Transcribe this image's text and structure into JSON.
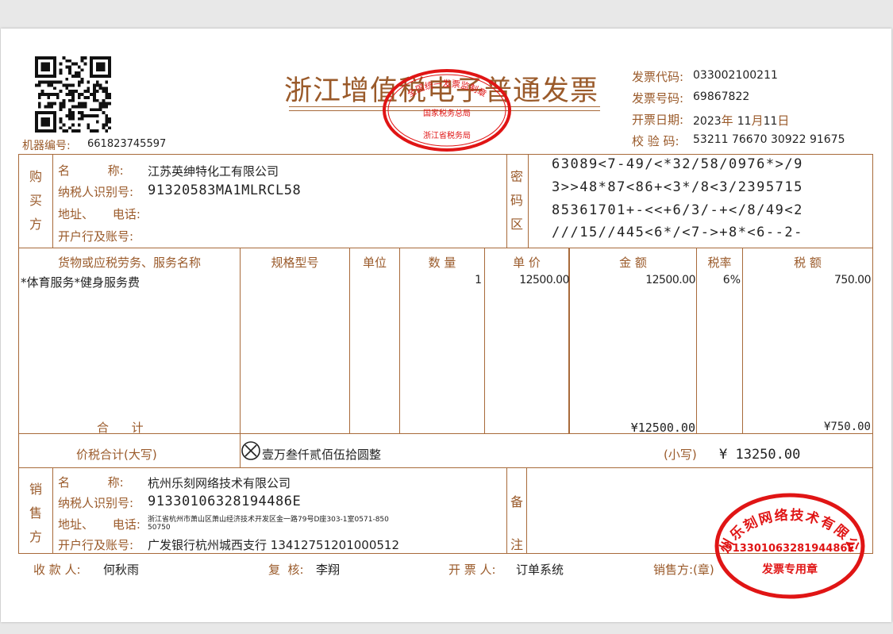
{
  "invoice": {
    "title": "浙江增值税电子普通发票",
    "machine_no_label": "机器编号:",
    "machine_no": "661823745597",
    "code_label": "发票代码:",
    "code": "033002100211",
    "number_label": "发票号码:",
    "number": "69867822",
    "date_label": "开票日期:",
    "date_year": "2023",
    "date_year_unit": "年",
    "date_month": "11",
    "date_month_unit": "月",
    "date_day": "11",
    "date_day_unit": "日",
    "check_label": "校 验 码:",
    "check_code": "53211 76670 30922 91675"
  },
  "tax_stamp": {
    "top_text": "全国统一发票监制章",
    "middle_text": "国家税务总局",
    "bottom_text": "浙江省税务局"
  },
  "buyer": {
    "side_label": [
      "购",
      "买",
      "方"
    ],
    "name_label": "名          称:",
    "name": "江苏英绅特化工有限公司",
    "tax_id_label": "纳税人识别号:",
    "tax_id": "91320583MA1MLRCL58",
    "address_label": "地址、     电话:",
    "address": "",
    "bank_label": "开户行及账号:",
    "bank": ""
  },
  "password_zone": {
    "side_label": [
      "密",
      "码",
      "区"
    ],
    "lines": [
      "63089<7-49/<*32/58/0976*>/9",
      "3>>48*87<86+<3*/8<3/2395715",
      "85361701+-<<+6/3/-+</8/49<2",
      "///15//445<6*/<7->+8*<6--2-"
    ]
  },
  "items_header": {
    "name": "货物或应税劳务、服务名称",
    "spec": "规格型号",
    "unit": "单位",
    "qty": "数 量",
    "price": "单 价",
    "amount": "金 额",
    "rate": "税率",
    "tax": "税 额"
  },
  "items": [
    {
      "name": "*体育服务*健身服务费",
      "spec": "",
      "unit": "",
      "qty": "1",
      "price": "12500.00",
      "amount": "12500.00",
      "rate": "6%",
      "tax": "750.00"
    }
  ],
  "totals": {
    "label": "合      计",
    "amount": "¥12500.00",
    "tax": "¥750.00",
    "grand_label": "价税合计(大写)",
    "grand_words": "壹万叁仟贰佰伍拾圆整",
    "small_label": "(小写)",
    "grand_number": "¥ 13250.00"
  },
  "seller": {
    "side_label": [
      "销",
      "售",
      "方"
    ],
    "name_label": "名          称:",
    "name": "杭州乐刻网络技术有限公司",
    "tax_id_label": "纳税人识别号:",
    "tax_id": "91330106328194486E",
    "address_label": "地址、     电话:",
    "address_line1": "浙江省杭州市萧山区萧山经济技术开发区金一路79号D座303-1室0571-850",
    "address_line2": "50750",
    "bank_label": "开户行及账号:",
    "bank": "广发银行杭州城西支行 13412751201000512"
  },
  "remarks": {
    "side_label": [
      "备",
      "注"
    ]
  },
  "seller_stamp": {
    "company": "杭州乐刻网络技术有限公司",
    "tax_id": "91330106328194486E",
    "caption": "发票专用章"
  },
  "footer": {
    "payee_label": "收 款 人:",
    "payee": "何秋雨",
    "reviewer_label": "复  核:",
    "reviewer": "李翔",
    "issuer_label": "开 票 人:",
    "issuer": "订单系统",
    "seller_label": "销售方:(章)"
  },
  "colors": {
    "frame": "#a86a3a",
    "label": "#9a5a2a",
    "stamp_red": "#e01515",
    "text": "#222222"
  }
}
